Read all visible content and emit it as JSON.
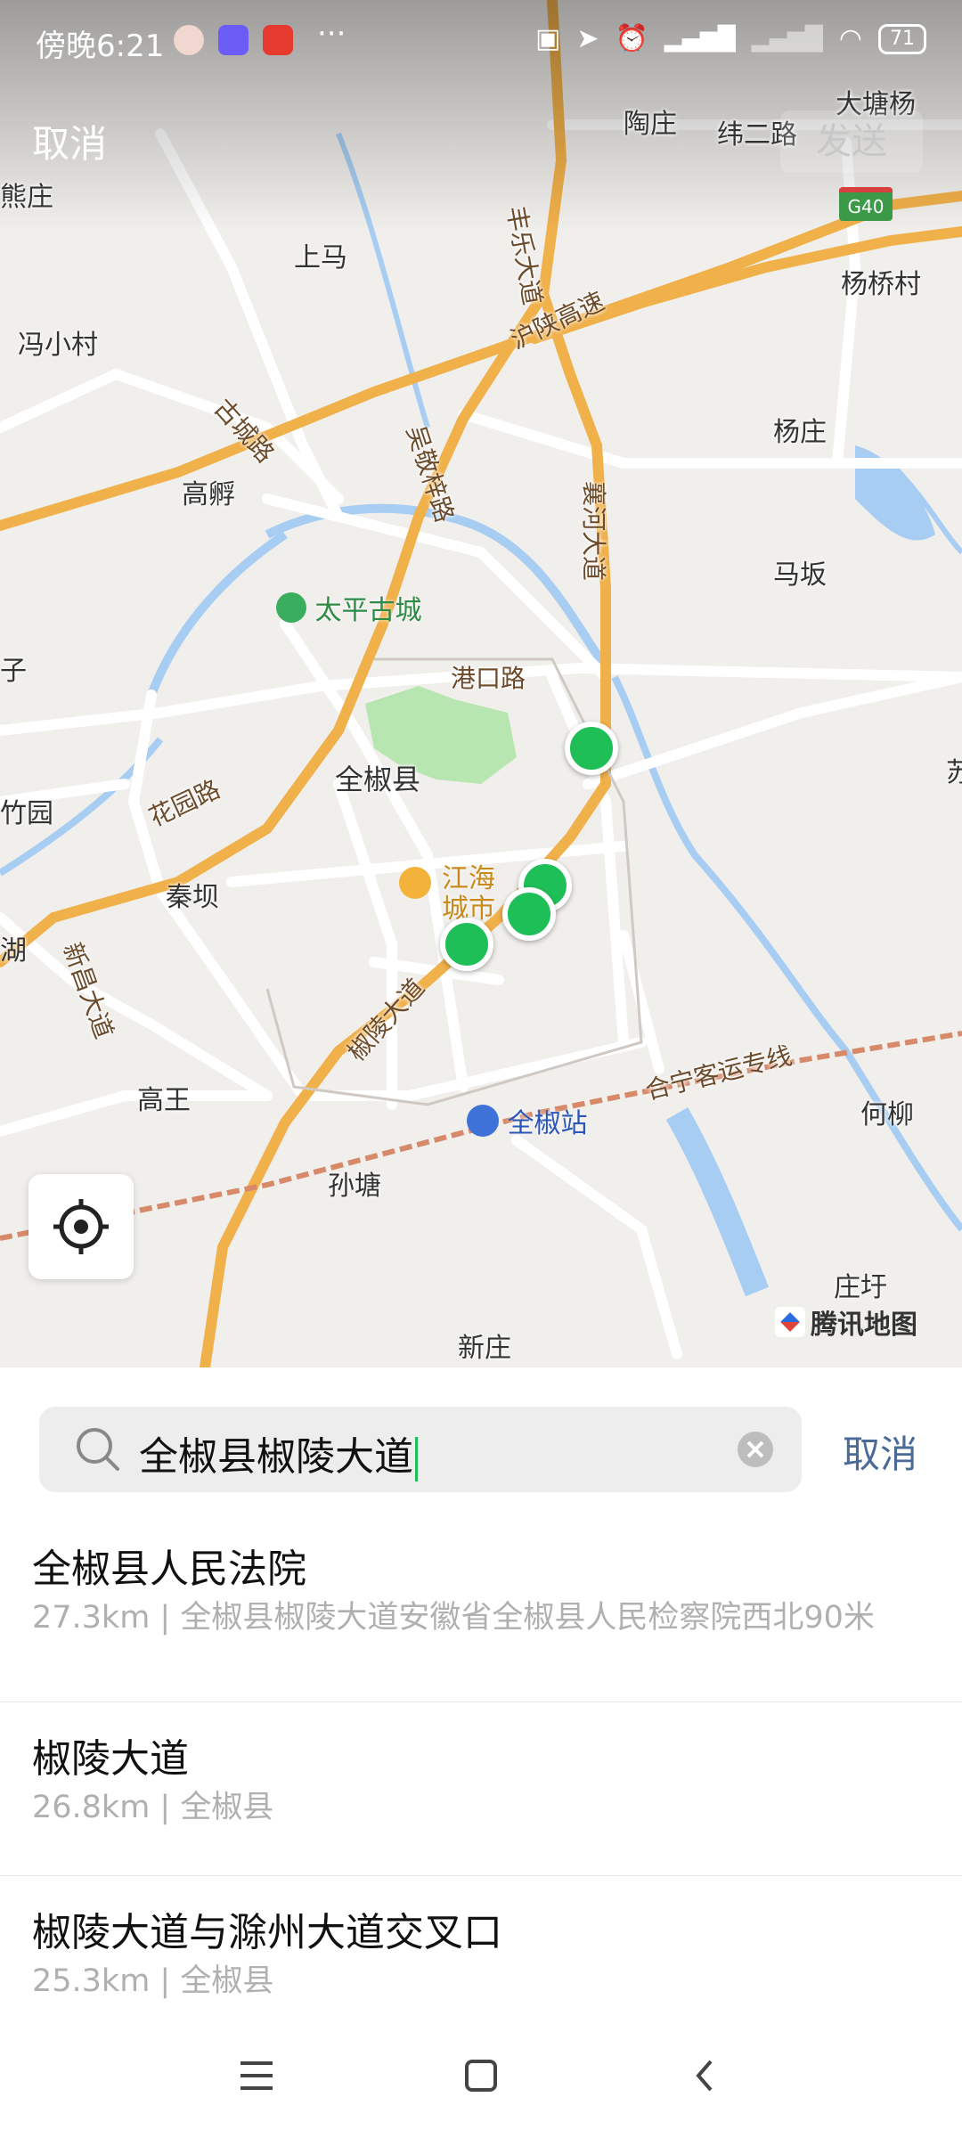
{
  "status_bar": {
    "time": "傍晚6:21",
    "more": "···",
    "battery": "71"
  },
  "header": {
    "cancel_label": "取消",
    "send_label": "发送"
  },
  "map": {
    "place_labels": [
      "陶庄",
      "纬二路",
      "大塘杨",
      "熊庄",
      "上马",
      "杨桥村",
      "冯小村",
      "杨庄",
      "高孵",
      "马坂",
      "全椒县",
      "竹园",
      "秦坝",
      "湖",
      "高王",
      "孙塘",
      "何柳",
      "庄圩",
      "新庄",
      "子",
      "苏"
    ],
    "road_labels": [
      "丰乐大道",
      "沪陕高速",
      "古城路",
      "吴敬梓路",
      "襄河大道",
      "港口路",
      "花园路",
      "新昌大道",
      "椒陵大道",
      "合宁客运专线"
    ],
    "highway_shield": "G40",
    "pois": {
      "scenic": "太平古城",
      "mall_line1": "江海",
      "mall_line2": "城市",
      "station": "全椒站"
    },
    "brand": "腾讯地图"
  },
  "search": {
    "query": "全椒县椒陵大道",
    "cancel_label": "取消"
  },
  "results": [
    {
      "title": "全椒县人民法院",
      "subtitle": "27.3km | 全椒县椒陵大道安徽省全椒县人民检察院西北90米"
    },
    {
      "title": "椒陵大道",
      "subtitle": "26.8km | 全椒县"
    },
    {
      "title": "椒陵大道与滁州大道交叉口",
      "subtitle": "25.3km | 全椒县"
    }
  ],
  "colors": {
    "marker": "#1fbf58",
    "accent_link": "#4a6b98",
    "highway": "#f0b04a",
    "water": "#a7cdf2"
  },
  "icons": [
    "search-icon",
    "clear-icon",
    "locate-icon",
    "menu-icon",
    "home-icon",
    "back-icon"
  ]
}
